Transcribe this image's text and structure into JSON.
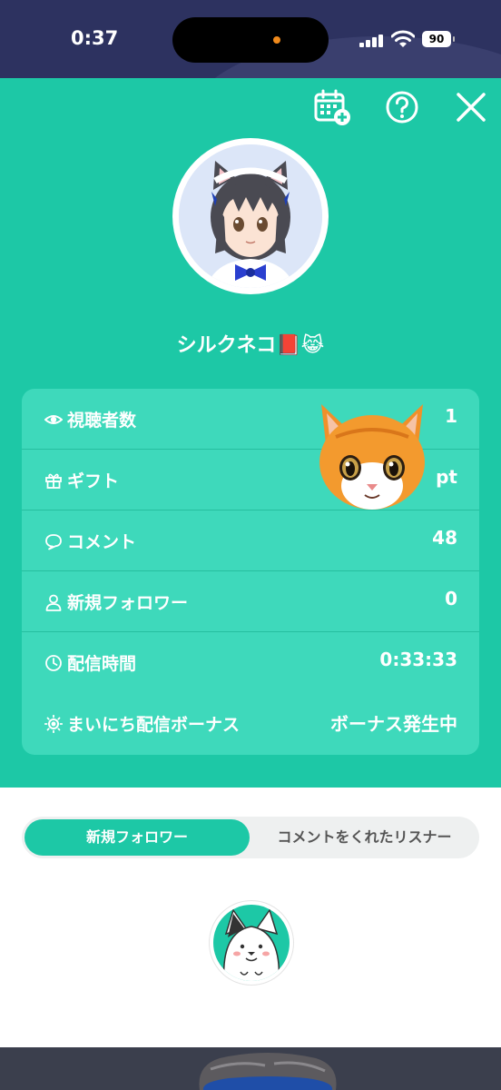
{
  "status_bar": {
    "time": "0:37",
    "battery": "90"
  },
  "header": {
    "username": "シルクネコ📕😹",
    "icons": [
      "calendar-plus-icon",
      "help-icon",
      "close-icon"
    ]
  },
  "stats": [
    {
      "icon": "eye-icon",
      "label": "視聴者数",
      "value": "1"
    },
    {
      "icon": "gift-icon",
      "label": "ギフト",
      "value": "pt"
    },
    {
      "icon": "comment-icon",
      "label": "コメント",
      "value": "48"
    },
    {
      "icon": "person-icon",
      "label": "新規フォロワー",
      "value": "0"
    },
    {
      "icon": "clock-icon",
      "label": "配信時間",
      "value": "0:33:33"
    },
    {
      "icon": "sun-icon",
      "label": "まいにち配信ボーナス",
      "value": "ボーナス発生中"
    }
  ],
  "tabs": [
    {
      "label": "新規フォロワー",
      "active": true
    },
    {
      "label": "コメントをくれたリスナー",
      "active": false
    }
  ],
  "colors": {
    "accent": "#1dc8a6",
    "card": "#3ed9bb",
    "statusbar": "#2d3260"
  }
}
